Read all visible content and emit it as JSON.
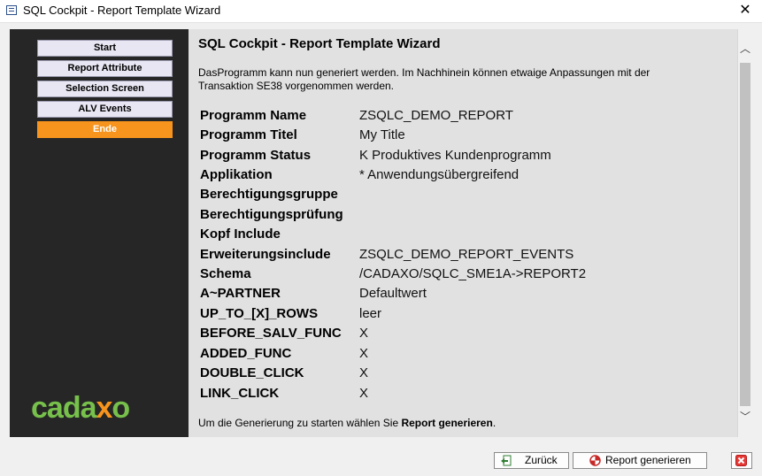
{
  "window": {
    "title": "SQL Cockpit - Report Template Wizard"
  },
  "sidebar": {
    "items": [
      {
        "label": "Start",
        "active": false
      },
      {
        "label": "Report Attribute",
        "active": false
      },
      {
        "label": "Selection Screen",
        "active": false
      },
      {
        "label": "ALV Events",
        "active": false
      },
      {
        "label": "Ende",
        "active": true
      }
    ],
    "logo": {
      "part1": "cada",
      "part2": "x",
      "part3": "o"
    }
  },
  "main": {
    "heading": "SQL Cockpit - Report Template Wizard",
    "intro": "DasProgramm kann nun generiert werden. Im Nachhinein können etwaige Anpassungen mit der Transaktion SE38 vorgenommen werden.",
    "fields": [
      {
        "label": "Programm Name",
        "value": "ZSQLC_DEMO_REPORT"
      },
      {
        "label": "Programm Titel",
        "value": "My Title"
      },
      {
        "label": "Programm Status",
        "value": "K Produktives Kundenprogramm"
      },
      {
        "label": "Applikation",
        "value": "* Anwendungsübergreifend"
      },
      {
        "label": "Berechtigungsgruppe",
        "value": ""
      },
      {
        "label": "Berechtigungsprüfung",
        "value": ""
      },
      {
        "label": "Kopf Include",
        "value": ""
      },
      {
        "label": "Erweiterungsinclude",
        "value": "ZSQLC_DEMO_REPORT_EVENTS"
      },
      {
        "label": "Schema",
        "value": "/CADAXO/SQLC_SME1A->REPORT2"
      },
      {
        "label": "A~PARTNER",
        "value": "Defaultwert"
      },
      {
        "label": "UP_TO_[X]_ROWS",
        "value": "leer"
      },
      {
        "label": "BEFORE_SALV_FUNC",
        "value": "X"
      },
      {
        "label": "ADDED_FUNC",
        "value": "X"
      },
      {
        "label": "DOUBLE_CLICK",
        "value": "X"
      },
      {
        "label": "LINK_CLICK",
        "value": "X"
      }
    ],
    "footer_prefix": "Um die Generierung zu starten wählen Sie ",
    "footer_bold": "Report generieren",
    "footer_suffix": "."
  },
  "buttons": {
    "back": "Zurück",
    "generate": "Report generieren"
  },
  "colors": {
    "accent": "#f7941d",
    "logo_green": "#76c04b",
    "sidebar_bg": "#262626",
    "content_bg": "#e1e1e1"
  }
}
